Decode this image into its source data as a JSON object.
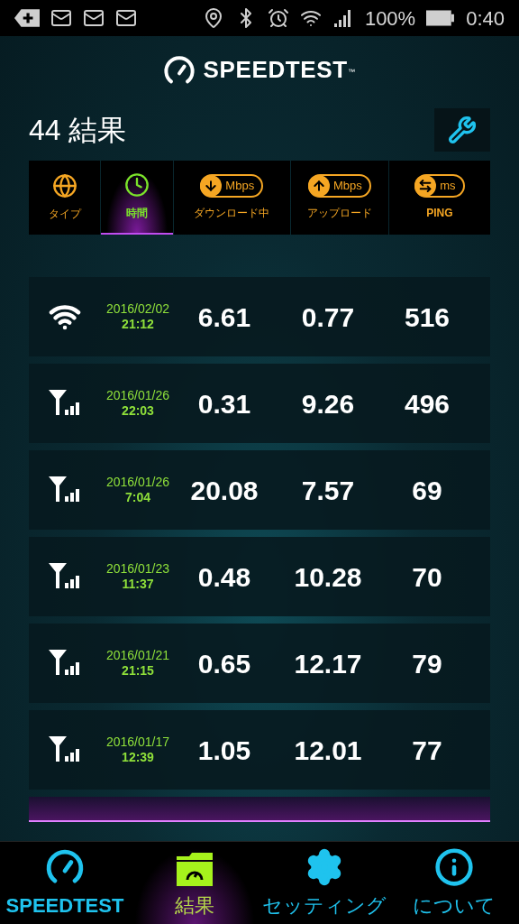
{
  "status_bar": {
    "battery": "100%",
    "time": "0:40"
  },
  "header": {
    "logo": "SPEEDTEST",
    "trademark": "™"
  },
  "title": "44 結果",
  "sort_tabs": [
    {
      "kind": "type",
      "label": "タイプ",
      "selected": false
    },
    {
      "kind": "time",
      "label": "時間",
      "selected": true
    },
    {
      "kind": "download",
      "unit": "Mbps",
      "label": "ダウンロード中",
      "selected": false
    },
    {
      "kind": "upload",
      "unit": "Mbps",
      "label": "アップロード",
      "selected": false
    },
    {
      "kind": "ping",
      "unit": "ms",
      "label": "PING",
      "selected": false
    }
  ],
  "results": [
    {
      "kind": "wifi",
      "date": "2016/02/02",
      "time": "21:12",
      "download": "6.61",
      "upload": "0.77",
      "ping": "516"
    },
    {
      "kind": "cellular",
      "date": "2016/01/26",
      "time": "22:03",
      "download": "0.31",
      "upload": "9.26",
      "ping": "496"
    },
    {
      "kind": "cellular",
      "date": "2016/01/26",
      "time": "7:04",
      "download": "20.08",
      "upload": "7.57",
      "ping": "69"
    },
    {
      "kind": "cellular",
      "date": "2016/01/23",
      "time": "11:37",
      "download": "0.48",
      "upload": "10.28",
      "ping": "70"
    },
    {
      "kind": "cellular",
      "date": "2016/01/21",
      "time": "21:15",
      "download": "0.65",
      "upload": "12.17",
      "ping": "79"
    },
    {
      "kind": "cellular",
      "date": "2016/01/17",
      "time": "12:39",
      "download": "1.05",
      "upload": "12.01",
      "ping": "77"
    }
  ],
  "nav": [
    {
      "kind": "speedtest",
      "label": "SPEEDTEST",
      "selected": false
    },
    {
      "kind": "results",
      "label": "結果",
      "selected": true
    },
    {
      "kind": "settings",
      "label": "セッティング",
      "selected": false
    },
    {
      "kind": "about",
      "label": "について",
      "selected": false
    }
  ]
}
